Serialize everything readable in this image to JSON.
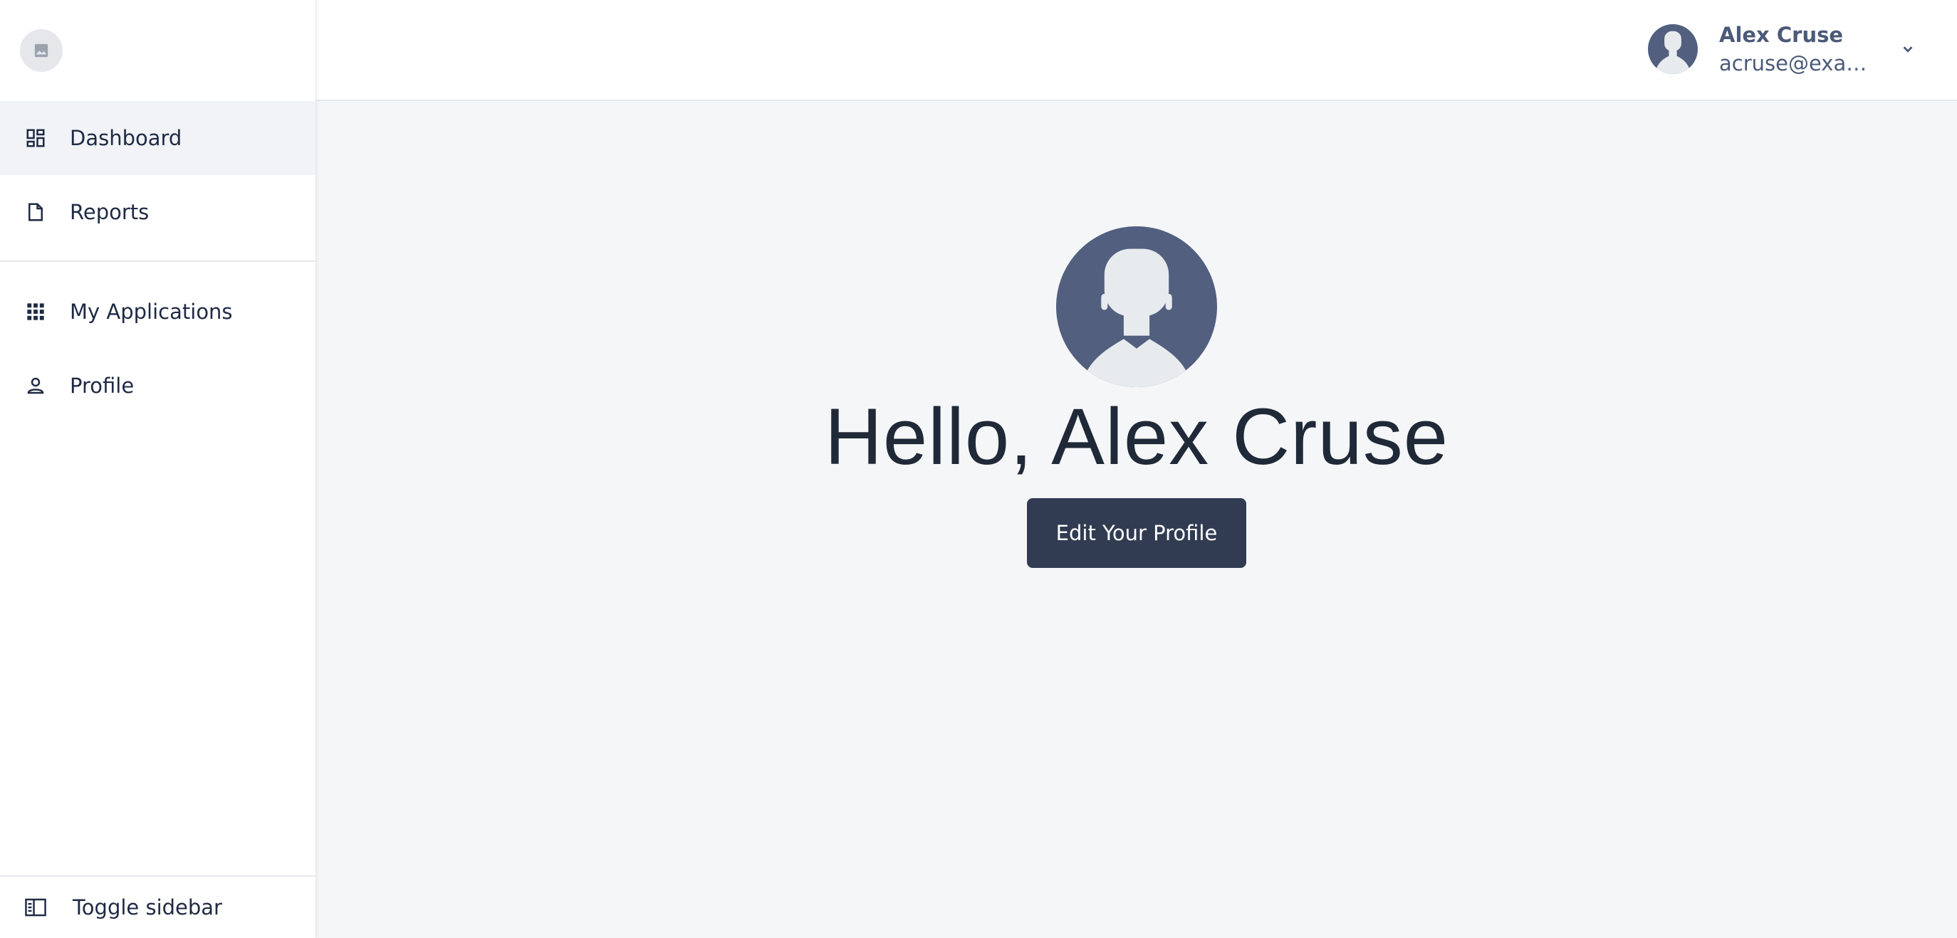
{
  "sidebar": {
    "logo_icon": "image-icon",
    "nav_primary": [
      {
        "label": "Dashboard",
        "icon": "dashboard-icon",
        "active": true
      },
      {
        "label": "Reports",
        "icon": "document-icon",
        "active": false
      }
    ],
    "nav_secondary": [
      {
        "label": "My Applications",
        "icon": "apps-grid-icon"
      },
      {
        "label": "Profile",
        "icon": "person-icon"
      }
    ],
    "footer": {
      "label": "Toggle sidebar",
      "icon": "sidebar-toggle-icon"
    }
  },
  "header": {
    "user": {
      "name": "Alex Cruse",
      "email": "acruse@exam..."
    }
  },
  "main": {
    "greeting": "Hello, Alex Cruse",
    "edit_button_label": "Edit Your Profile"
  },
  "colors": {
    "sidebar_bg": "#ffffff",
    "content_bg": "#f5f6f8",
    "active_item_bg": "#f1f3f6",
    "avatar_bg": "#525f7f",
    "avatar_figure": "#e7ebee",
    "button_bg": "#313c52",
    "button_text": "#ffffff"
  }
}
